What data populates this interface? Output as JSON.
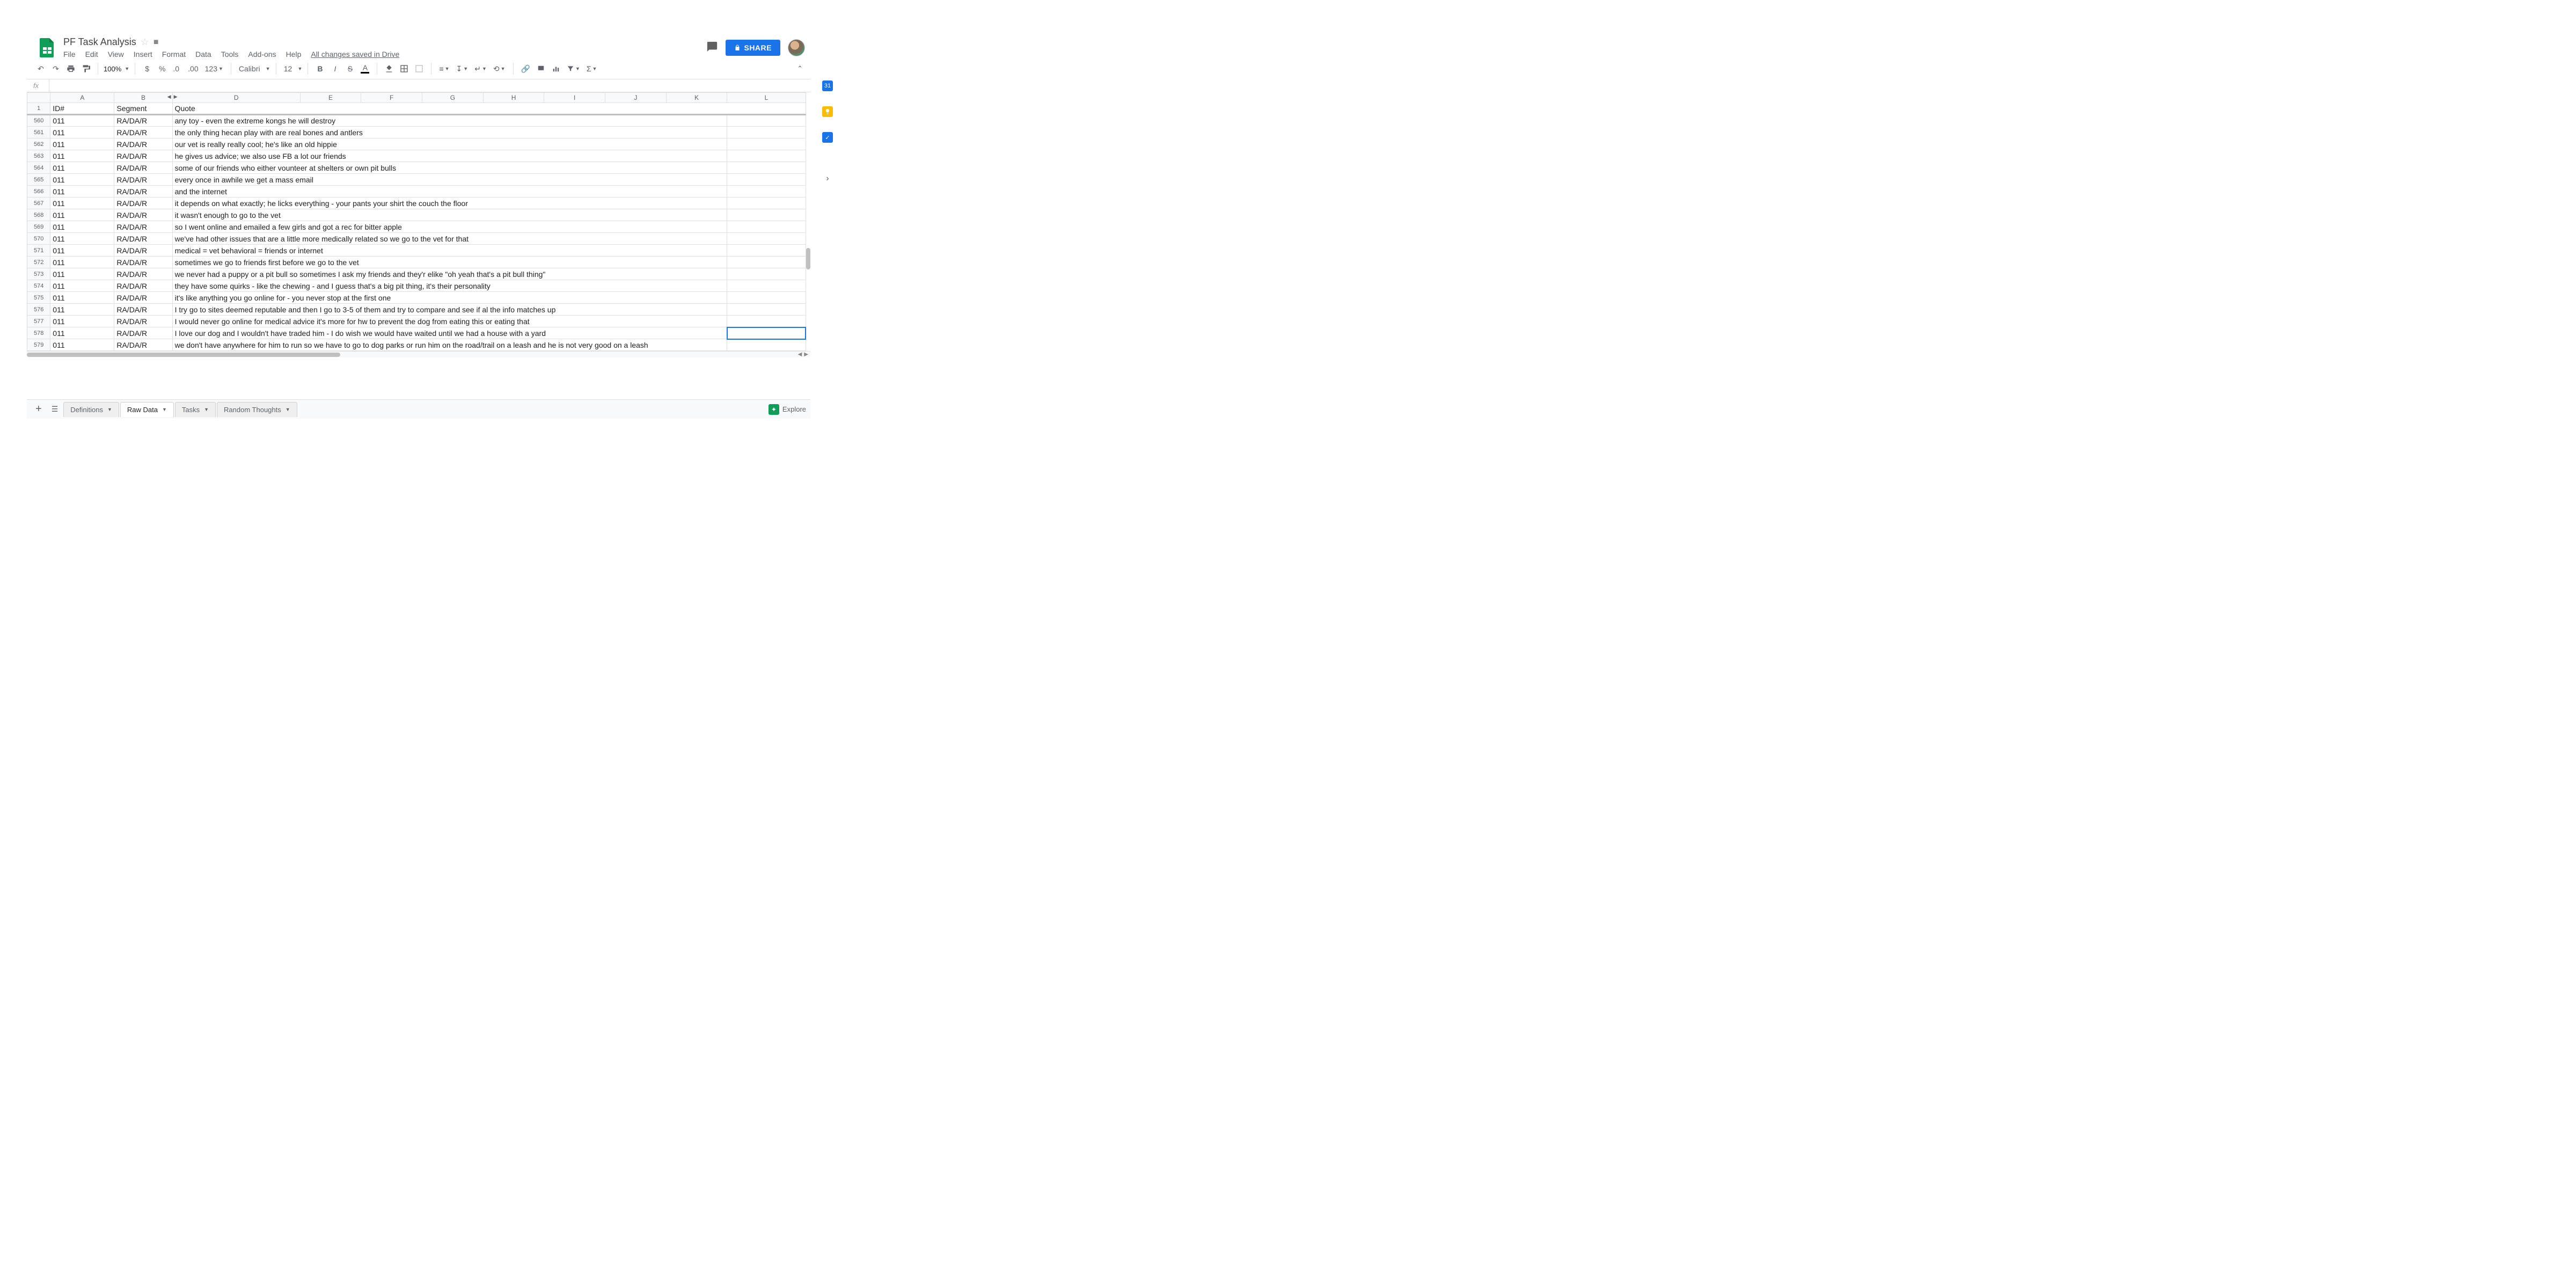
{
  "doc": {
    "title": "PF Task Analysis",
    "saved": "All changes saved in Drive"
  },
  "menus": [
    "File",
    "Edit",
    "View",
    "Insert",
    "Format",
    "Data",
    "Tools",
    "Add-ons",
    "Help"
  ],
  "share": "SHARE",
  "zoom": "100%",
  "font": "Calibri",
  "fontsize": "12",
  "formula": "",
  "columns": [
    "A",
    "B",
    "D",
    "E",
    "F",
    "G",
    "H",
    "I",
    "J",
    "K",
    "L"
  ],
  "header": {
    "A": "ID#",
    "B": "Segment",
    "D": "Quote"
  },
  "rows": [
    {
      "n": "560",
      "A": "011",
      "B": "RA/DA/R",
      "D": "any toy - even the extreme kongs he will destroy"
    },
    {
      "n": "561",
      "A": "011",
      "B": "RA/DA/R",
      "D": "the only thing hecan play with are real bones and antlers"
    },
    {
      "n": "562",
      "A": "011",
      "B": "RA/DA/R",
      "D": "our vet is really really cool; he's like an old hippie"
    },
    {
      "n": "563",
      "A": "011",
      "B": "RA/DA/R",
      "D": "he gives us advice; we also use FB a lot our friends"
    },
    {
      "n": "564",
      "A": "011",
      "B": "RA/DA/R",
      "D": "some of our friends who either vounteer at shelters or own pit bulls"
    },
    {
      "n": "565",
      "A": "011",
      "B": "RA/DA/R",
      "D": "every once in awhile we get a mass email"
    },
    {
      "n": "566",
      "A": "011",
      "B": "RA/DA/R",
      "D": "and the internet"
    },
    {
      "n": "567",
      "A": "011",
      "B": "RA/DA/R",
      "D": "it depends on what exactly; he licks everything - your pants your shirt the couch the floor"
    },
    {
      "n": "568",
      "A": "011",
      "B": "RA/DA/R",
      "D": "it wasn't enough to go to the vet"
    },
    {
      "n": "569",
      "A": "011",
      "B": "RA/DA/R",
      "D": "so I went online and emailed a few girls and got a rec for bitter apple"
    },
    {
      "n": "570",
      "A": "011",
      "B": "RA/DA/R",
      "D": "we've had other issues that are a little more medically related so we go to the vet for that"
    },
    {
      "n": "571",
      "A": "011",
      "B": "RA/DA/R",
      "D": "medical = vet behavioral = friends or internet"
    },
    {
      "n": "572",
      "A": "011",
      "B": "RA/DA/R",
      "D": "sometimes we go to friends first before we go to the vet"
    },
    {
      "n": "573",
      "A": "011",
      "B": "RA/DA/R",
      "D": "we never had a puppy or a pit bull so sometimes I ask my friends and they'r elike \"oh yeah that's a pit bull thing\""
    },
    {
      "n": "574",
      "A": "011",
      "B": "RA/DA/R",
      "D": "they have some quirks - like the chewing - and I guess that's a big pit thing, it's their personality"
    },
    {
      "n": "575",
      "A": "011",
      "B": "RA/DA/R",
      "D": "it's like anything you go online for - you never stop at the first one"
    },
    {
      "n": "576",
      "A": "011",
      "B": "RA/DA/R",
      "D": "I try go to sites deemed reputable and then I go to 3-5 of them and try to compare and see if al the info matches up"
    },
    {
      "n": "577",
      "A": "011",
      "B": "RA/DA/R",
      "D": "I would never go online for medical advice it's more for hw to prevent the dog from eating this or eating that"
    },
    {
      "n": "578",
      "A": "011",
      "B": "RA/DA/R",
      "D": "I love our dog and I wouldn't have traded him - I do wish we would have waited until we had a house with a yard"
    },
    {
      "n": "579",
      "A": "011",
      "B": "RA/DA/R",
      "D": "we don't have anywhere for him to run so we have to go to dog parks or run him on the road/trail on a leash and he is not very good on a leash"
    }
  ],
  "frozen_row_num": "1",
  "tabs": [
    "Definitions",
    "Raw Data",
    "Tasks",
    "Random Thoughts"
  ],
  "active_tab": 1,
  "explore": "Explore",
  "calendar_day": "31"
}
